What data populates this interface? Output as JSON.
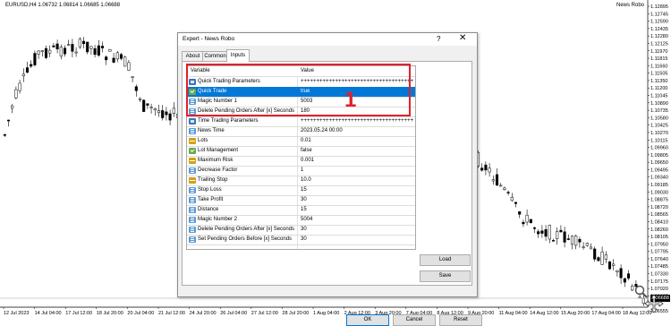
{
  "chart": {
    "symbol_label": "EURUSD,H4  1.06732 1.06814 1.06685 1.06688",
    "ea_label": "News Robo",
    "current_price": "1.06688",
    "price_ticks": [
      "1.12895",
      "1.12745",
      "1.12590",
      "1.12435",
      "1.12280",
      "1.12125",
      "1.11970",
      "1.11815",
      "1.11660",
      "1.11505",
      "1.11350",
      "1.11200",
      "1.11045",
      "1.10890",
      "1.10735",
      "1.10580",
      "1.10425",
      "1.10270",
      "1.10115",
      "1.09960",
      "1.09805",
      "1.09650",
      "1.09495",
      "1.09340",
      "1.09185",
      "1.09030",
      "1.08875",
      "1.08720",
      "1.08565",
      "1.08410",
      "1.08260",
      "1.08105",
      "1.07950",
      "1.07795",
      "1.07640",
      "1.07485",
      "1.07330",
      "1.07175",
      "1.07020",
      "1.06865",
      "1.06688",
      "1.06555"
    ],
    "time_ticks": [
      "12 Jul 2023",
      "14 Jul 04:00",
      "17 Jul 12:00",
      "18 Jul 20:00",
      "20 Jul 04:00",
      "21 Jul 12:00",
      "24 Jul 20:00",
      "26 Jul 04:00",
      "27 Jul 12:00",
      "28 Jul 20:00",
      "1 Aug 04:00",
      "2 Aug 12:00",
      "3 Aug 20:00",
      "7 Aug 04:00",
      "8 Aug 12:00",
      "9 Aug 20:00",
      "11 Aug 04:00",
      "14 Aug 12:00",
      "15 Aug 20:00",
      "17 Aug 04:00",
      "18 Aug 12:00"
    ]
  },
  "dialog": {
    "title": "Expert - News Robo",
    "help_label": "?",
    "close_label": "✕",
    "tabs": [
      "About",
      "Common",
      "Inputs"
    ],
    "active_tab": "Inputs",
    "columns": {
      "variable": "Variable",
      "value": "Value"
    },
    "rows": [
      {
        "icon": "ab",
        "name": "Quick Trading Parameters",
        "value": "++++++++++++++++++++++++++++++++++++"
      },
      {
        "icon": "check",
        "name": "Quick Trade",
        "value": "true",
        "selected": true
      },
      {
        "icon": "lines",
        "name": "Magic Number 1",
        "value": "5003"
      },
      {
        "icon": "lines",
        "name": "Delete Pending Orders After [x] Seconds",
        "value": "180"
      },
      {
        "icon": "ab",
        "name": "Time Trading Parameters",
        "value": "++++++++++++++++++++++++++++++++++++"
      },
      {
        "icon": "lines",
        "name": "News Time",
        "value": "2023.05.24 00:00"
      },
      {
        "icon": "ls",
        "name": "Lots",
        "value": "0.01"
      },
      {
        "icon": "check",
        "name": "Lot Management",
        "value": "false"
      },
      {
        "icon": "ls",
        "name": "Maximum Risk",
        "value": "0.001"
      },
      {
        "icon": "lines",
        "name": "Decrease Factor",
        "value": "1"
      },
      {
        "icon": "ls",
        "name": "Trailing Stop",
        "value": "10.0"
      },
      {
        "icon": "lines",
        "name": "Stop Loss",
        "value": "15"
      },
      {
        "icon": "lines",
        "name": "Take Profit",
        "value": "30"
      },
      {
        "icon": "lines",
        "name": "Distance",
        "value": "15"
      },
      {
        "icon": "lines",
        "name": "Magic Number 2",
        "value": "5004"
      },
      {
        "icon": "lines",
        "name": "Delete Pending Orders After [x] Seconds",
        "value": "30"
      },
      {
        "icon": "lines",
        "name": "Set Pending Orders Before [x] Seconds",
        "value": "30"
      }
    ],
    "buttons": {
      "load": "Load",
      "save": "Save",
      "ok": "OK",
      "cancel": "Cancel",
      "reset": "Reset"
    }
  },
  "annotation": {
    "number": "1",
    "color": "#e0212d"
  },
  "colors": {
    "selection": "#0078d7",
    "candle_up": "#ffffff",
    "candle_down": "#000000"
  }
}
